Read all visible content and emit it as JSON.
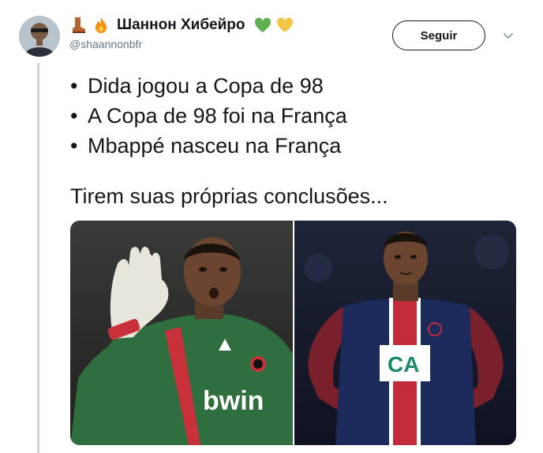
{
  "tweet": {
    "display_name": "Шаннон Хибейро",
    "handle": "@shaannonbfr",
    "follow_label": "Seguir",
    "name_emoji_icons": [
      "boot-icon",
      "fire-icon"
    ],
    "name_suffix_icons": [
      "green-heart-icon",
      "yellow-heart-icon"
    ],
    "bullets": [
      {
        "marker": "•",
        "text": "Dida jogou a Copa de 98"
      },
      {
        "marker": "•",
        "text": "A Copa de 98 foi na França"
      },
      {
        "marker": "•",
        "text": "Mbappé nasceu na França"
      }
    ],
    "conclusion": "Tirem suas próprias conclusões...",
    "photos": {
      "left": {
        "shirt_brand": "bwin"
      },
      "right": {
        "shirt_brand": "CA"
      }
    }
  },
  "colors": {
    "text": "#14171a",
    "secondary": "#657786",
    "thread_line": "#ccd6dd",
    "green_heart": "#5fb04f",
    "yellow_heart": "#f4c542",
    "milan_green": "#2f6e3f",
    "psg_navy": "#1c2a5c"
  }
}
